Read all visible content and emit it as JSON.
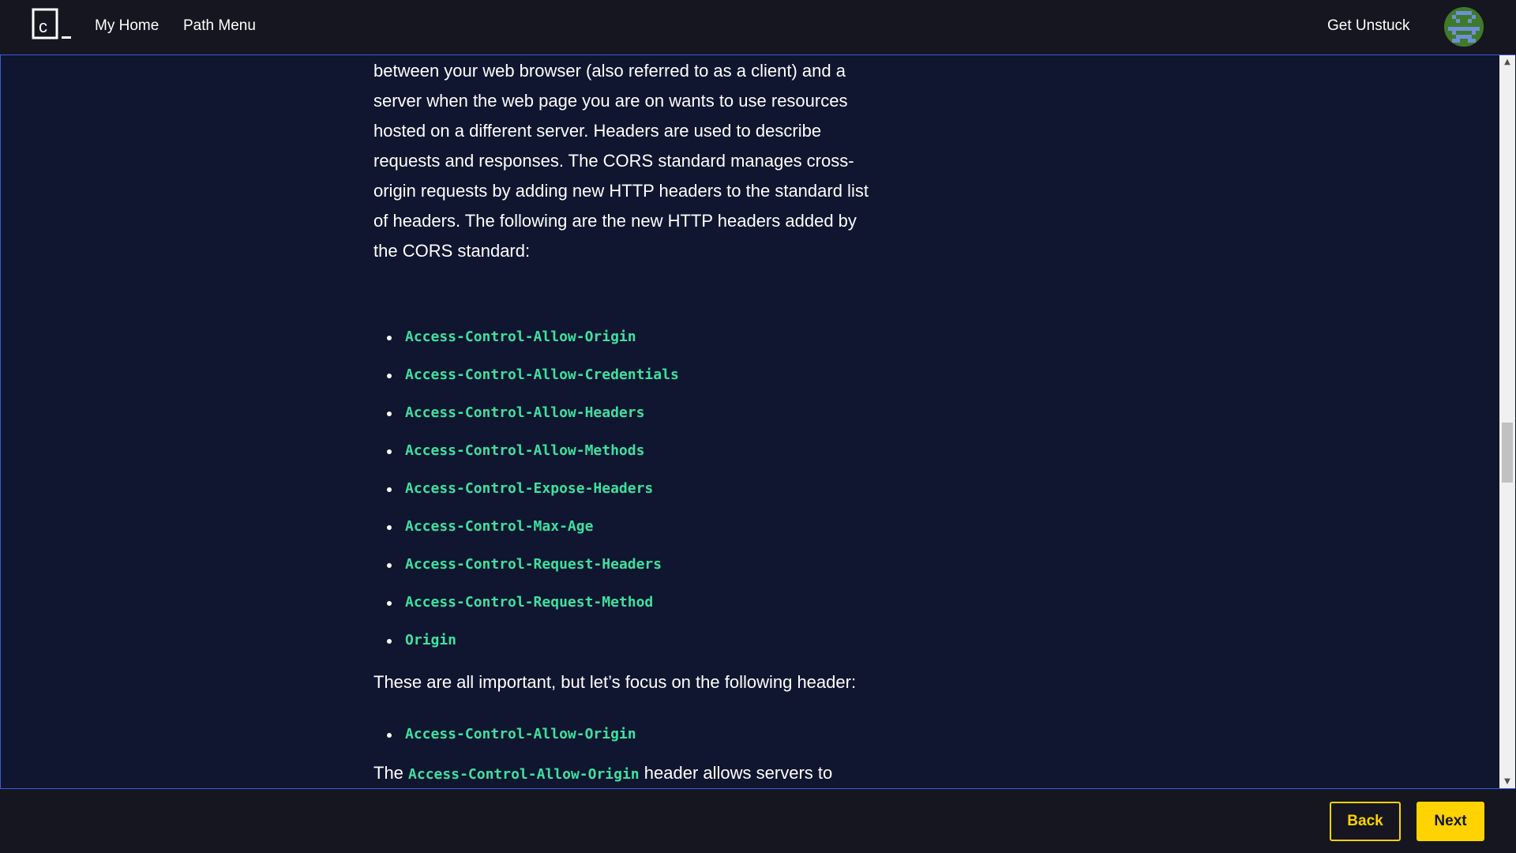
{
  "nav": {
    "logo_text": "c",
    "home": "My Home",
    "path_menu": "Path Menu",
    "get_unstuck": "Get Unstuck"
  },
  "article": {
    "intro_paragraph": "between your web browser (also referred to as a client) and a server when the web page you are on wants to use resources hosted on a different server. Headers are used to describe requests and responses. The CORS standard manages cross-origin requests by adding new HTTP headers to the standard list of headers. The following are the new HTTP headers added by the CORS standard:",
    "headers": [
      "Access-Control-Allow-Origin",
      "Access-Control-Allow-Credentials",
      "Access-Control-Allow-Headers",
      "Access-Control-Allow-Methods",
      "Access-Control-Expose-Headers",
      "Access-Control-Max-Age",
      "Access-Control-Request-Headers",
      "Access-Control-Request-Method",
      "Origin"
    ],
    "focus_paragraph": "These are all important, but let’s focus on the following header:",
    "focus_headers": [
      "Access-Control-Allow-Origin"
    ],
    "closing_prefix": "The",
    "closing_code": "Access-Control-Allow-Origin",
    "closing_suffix": "header allows servers to specify how their resources are shared with external domains."
  },
  "footer": {
    "back": "Back",
    "next": "Next"
  },
  "colors": {
    "background": "#10162f",
    "bar": "#15161f",
    "code": "#3fe0a0",
    "accent": "#ffd300",
    "frame_border": "#3b5bd6"
  }
}
